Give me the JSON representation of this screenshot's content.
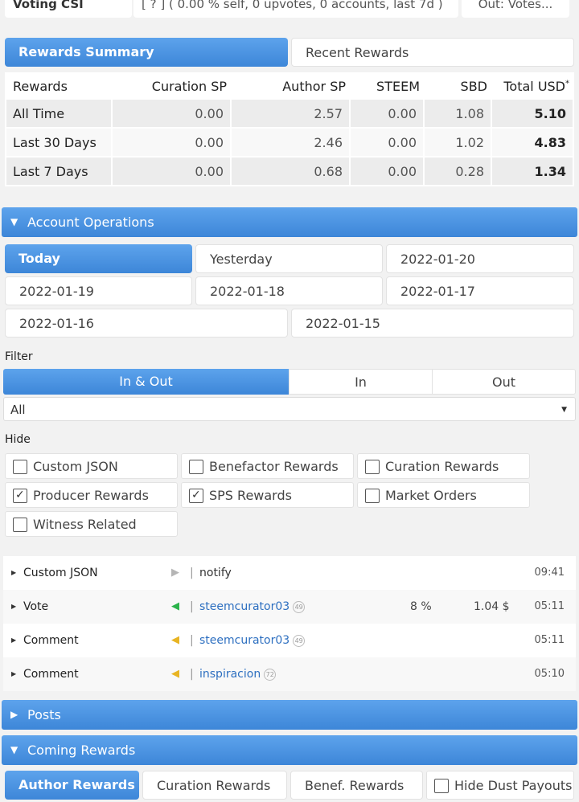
{
  "top_row": {
    "label": "Voting CSI",
    "value": "[ ? ] ( 0.00 % self, 0 upvotes, 0 accounts, last 7d )",
    "button": "Out: Votes..."
  },
  "rewards_tabs": [
    {
      "label": "Rewards Summary",
      "active": true
    },
    {
      "label": "Recent Rewards",
      "active": false
    }
  ],
  "rewards_table": {
    "headers": [
      "Rewards",
      "Curation SP",
      "Author SP",
      "STEEM",
      "SBD",
      "Total USD"
    ],
    "total_marker": "*",
    "rows": [
      {
        "label": "All Time",
        "curation_sp": "0.00",
        "author_sp": "2.57",
        "steem": "0.00",
        "sbd": "1.08",
        "total_usd": "5.10"
      },
      {
        "label": "Last 30 Days",
        "curation_sp": "0.00",
        "author_sp": "2.46",
        "steem": "0.00",
        "sbd": "1.02",
        "total_usd": "4.83"
      },
      {
        "label": "Last 7 Days",
        "curation_sp": "0.00",
        "author_sp": "0.68",
        "steem": "0.00",
        "sbd": "0.28",
        "total_usd": "1.34"
      }
    ]
  },
  "account_operations": {
    "title": "Account Operations",
    "days": [
      "Today",
      "Yesterday",
      "2022-01-20",
      "2022-01-19",
      "2022-01-18",
      "2022-01-17",
      "2022-01-16",
      "2022-01-15"
    ],
    "filter_label": "Filter",
    "filter_options": [
      "In & Out",
      "In",
      "Out"
    ],
    "filter_selected": "In & Out",
    "type_select": "All",
    "hide_label": "Hide",
    "hide_options": [
      {
        "label": "Custom JSON",
        "checked": false
      },
      {
        "label": "Benefactor Rewards",
        "checked": false
      },
      {
        "label": "Curation Rewards",
        "checked": false
      },
      {
        "label": "Producer Rewards",
        "checked": true
      },
      {
        "label": "SPS Rewards",
        "checked": true
      },
      {
        "label": "Market Orders",
        "checked": false
      },
      {
        "label": "Witness Related",
        "checked": false
      }
    ],
    "operations": [
      {
        "type": "Custom JSON",
        "direction": "neutral",
        "note": "notify",
        "time": "09:41"
      },
      {
        "type": "Vote",
        "direction": "in",
        "account": "steemcurator03",
        "reputation": "49",
        "percent": "8 %",
        "value": "1.04 $",
        "time": "05:11"
      },
      {
        "type": "Comment",
        "direction": "out",
        "account": "steemcurator03",
        "reputation": "49",
        "time": "05:11"
      },
      {
        "type": "Comment",
        "direction": "out",
        "account": "inspiracion",
        "reputation": "72",
        "time": "05:10"
      }
    ],
    "colors": {
      "neutral": "#b5b5b5",
      "in": "#2bb34b",
      "out": "#e8b423"
    }
  },
  "posts": {
    "title": "Posts"
  },
  "coming_rewards": {
    "title": "Coming Rewards",
    "tabs": [
      "Author Rewards",
      "Curation Rewards",
      "Benef. Rewards"
    ],
    "hide_dust": {
      "label": "Hide Dust Payouts",
      "checked": false
    }
  },
  "accent_color": "#3d86d8"
}
